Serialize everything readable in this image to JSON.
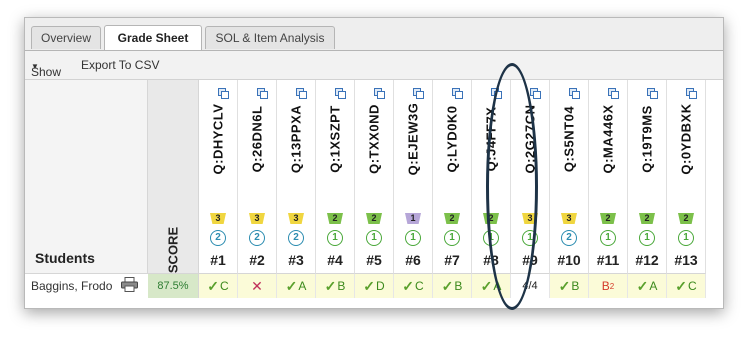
{
  "tabs": [
    {
      "label": "Overview",
      "active": false
    },
    {
      "label": "Grade Sheet",
      "active": true
    },
    {
      "label": "SOL & Item Analysis",
      "active": false
    }
  ],
  "toolbar": {
    "show_label": "Show",
    "export_label": "Export To CSV"
  },
  "header": {
    "students_label": "Students",
    "score_label": "SCORE"
  },
  "colors": {
    "level_yellow": "#f0d640",
    "level_green": "#7cc04a",
    "level_purple": "#b6a6d8",
    "circle_blue": "#2b8cb0",
    "circle_green": "#4aa83a",
    "highlight_oval": "#1e3347"
  },
  "questions": [
    {
      "id": "Q:DHYCLV",
      "level": "3",
      "level_color": "yellow",
      "circle": "2",
      "circle_color": "blue",
      "num": "#1"
    },
    {
      "id": "Q:26DN6L",
      "level": "3",
      "level_color": "yellow",
      "circle": "2",
      "circle_color": "blue",
      "num": "#2"
    },
    {
      "id": "Q:13PPXA",
      "level": "3",
      "level_color": "yellow",
      "circle": "2",
      "circle_color": "blue",
      "num": "#3"
    },
    {
      "id": "Q:1XSZPT",
      "level": "2",
      "level_color": "green",
      "circle": "1",
      "circle_color": "green",
      "num": "#4"
    },
    {
      "id": "Q:TXX0ND",
      "level": "2",
      "level_color": "green",
      "circle": "1",
      "circle_color": "green",
      "num": "#5"
    },
    {
      "id": "Q:EJEW3G",
      "level": "1",
      "level_color": "purple",
      "circle": "1",
      "circle_color": "green",
      "num": "#6"
    },
    {
      "id": "Q:LYD0K0",
      "level": "2",
      "level_color": "green",
      "circle": "1",
      "circle_color": "green",
      "num": "#7"
    },
    {
      "id": "Q:J4FF7X",
      "level": "2",
      "level_color": "green",
      "circle": "1",
      "circle_color": "green",
      "num": "#8"
    },
    {
      "id": "Q:2G27CN",
      "level": "3",
      "level_color": "yellow",
      "circle": "1",
      "circle_color": "green",
      "num": "#9"
    },
    {
      "id": "Q:S5NT04",
      "level": "3",
      "level_color": "yellow",
      "circle": "2",
      "circle_color": "blue",
      "num": "#10"
    },
    {
      "id": "Q:MA446X",
      "level": "2",
      "level_color": "green",
      "circle": "1",
      "circle_color": "green",
      "num": "#11"
    },
    {
      "id": "Q:19T9MS",
      "level": "2",
      "level_color": "green",
      "circle": "1",
      "circle_color": "green",
      "num": "#12"
    },
    {
      "id": "Q:0YDBXK",
      "level": "2",
      "level_color": "green",
      "circle": "1",
      "circle_color": "green",
      "num": "#13"
    }
  ],
  "students": [
    {
      "name": "Baggins, Frodo",
      "score": "87.5%",
      "answers": [
        {
          "type": "correct",
          "mark": "✓",
          "letter": "C"
        },
        {
          "type": "wrong",
          "mark": "✕",
          "letter": ""
        },
        {
          "type": "correct",
          "mark": "✓",
          "letter": "A"
        },
        {
          "type": "correct",
          "mark": "✓",
          "letter": "B"
        },
        {
          "type": "correct",
          "mark": "✓",
          "letter": "D"
        },
        {
          "type": "correct",
          "mark": "✓",
          "letter": "C"
        },
        {
          "type": "correct",
          "mark": "✓",
          "letter": "B"
        },
        {
          "type": "correct",
          "mark": "✓",
          "letter": "A"
        },
        {
          "type": "ratio",
          "mark": "4/4",
          "letter": ""
        },
        {
          "type": "correct",
          "mark": "✓",
          "letter": "B"
        },
        {
          "type": "incorrect",
          "mark": "B",
          "letter": "2"
        },
        {
          "type": "correct",
          "mark": "✓",
          "letter": "A"
        },
        {
          "type": "correct",
          "mark": "✓",
          "letter": "C"
        }
      ]
    }
  ]
}
